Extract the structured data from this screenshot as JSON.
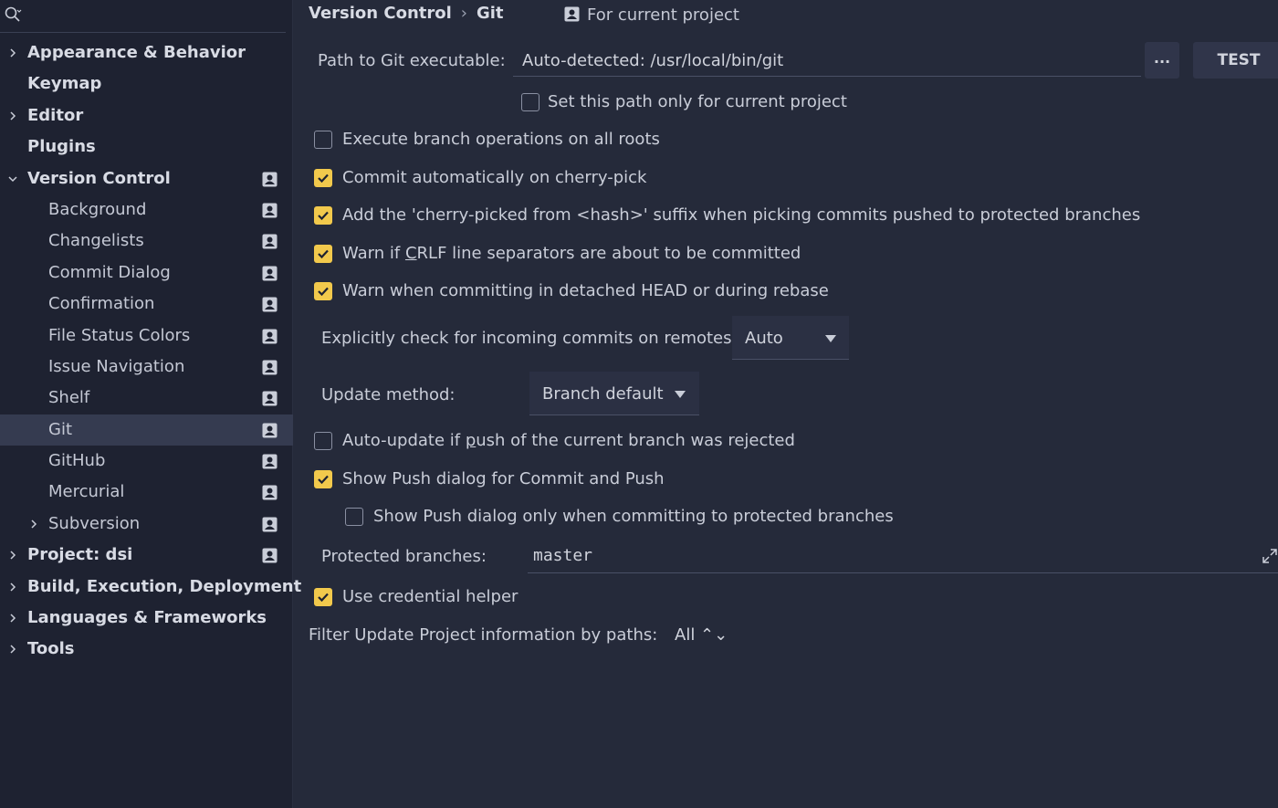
{
  "sidebar": {
    "search_icon": "search-icon",
    "items": [
      {
        "label": "Appearance & Behavior",
        "bold": true,
        "expandable": true,
        "expanded": false
      },
      {
        "label": "Keymap",
        "bold": true
      },
      {
        "label": "Editor",
        "bold": true,
        "expandable": true,
        "expanded": false
      },
      {
        "label": "Plugins",
        "bold": true
      },
      {
        "label": "Version Control",
        "bold": true,
        "expandable": true,
        "expanded": true,
        "project": true
      },
      {
        "label": "Background",
        "child": true,
        "project": true
      },
      {
        "label": "Changelists",
        "child": true,
        "project": true
      },
      {
        "label": "Commit Dialog",
        "child": true,
        "project": true
      },
      {
        "label": "Confirmation",
        "child": true,
        "project": true
      },
      {
        "label": "File Status Colors",
        "child": true,
        "project": true
      },
      {
        "label": "Issue Navigation",
        "child": true,
        "project": true
      },
      {
        "label": "Shelf",
        "child": true,
        "project": true
      },
      {
        "label": "Git",
        "child": true,
        "project": true,
        "selected": true
      },
      {
        "label": "GitHub",
        "child": true,
        "project": true
      },
      {
        "label": "Mercurial",
        "child": true,
        "project": true
      },
      {
        "label": "Subversion",
        "child": true,
        "project": true,
        "expandable": true
      },
      {
        "label": "Project: dsi",
        "bold": true,
        "expandable": true,
        "project": true
      },
      {
        "label": "Build, Execution, Deployment",
        "bold": true,
        "expandable": true
      },
      {
        "label": "Languages & Frameworks",
        "bold": true,
        "expandable": true
      },
      {
        "label": "Tools",
        "bold": true,
        "expandable": true
      }
    ]
  },
  "header": {
    "crumb1": "Version Control",
    "separator": "›",
    "crumb2": "Git",
    "for_project": "For current project"
  },
  "git": {
    "path_label": "Path to Git executable:",
    "path_value": "Auto-detected: /usr/local/bin/git",
    "browse_label": "...",
    "test_label": "TEST",
    "path_only_project": {
      "label": "Set this path only for current project",
      "checked": false
    },
    "execute_all_roots": {
      "label": "Execute branch operations on all roots",
      "checked": false
    },
    "commit_cherry_pick": {
      "label": "Commit automatically on cherry-pick",
      "checked": true
    },
    "cherry_suffix": {
      "label": "Add the 'cherry-picked from <hash>' suffix when picking commits pushed to protected branches",
      "checked": true
    },
    "warn_crlf": {
      "label_pre": "Warn if ",
      "label_u": "C",
      "label_post": "RLF line separators are about to be committed",
      "checked": true
    },
    "warn_detached": {
      "label": "Warn when committing in detached HEAD or during rebase",
      "checked": true
    },
    "incoming_label": "Explicitly check for incoming commits on remotes:",
    "incoming_value": "Auto",
    "update_method_label": "Update method:",
    "update_method_value": "Branch default",
    "auto_update": {
      "label_pre": "Auto-update if ",
      "label_u": "p",
      "label_post": "ush of the current branch was rejected",
      "checked": false
    },
    "show_push": {
      "label": "Show Push dialog for Commit and Push",
      "checked": true
    },
    "show_push_protected": {
      "label": "Show Push dialog only when committing to protected branches",
      "checked": false
    },
    "protected_label": "Protected branches:",
    "protected_value": "master",
    "credential_helper": {
      "label": "Use credential helper",
      "checked": true
    },
    "filter_label": "Filter Update Project information by paths:",
    "filter_value": "All ⌃⌄"
  },
  "colors": {
    "accent_checkbox": "#f2c94c",
    "background": "#252a3a",
    "sidebar": "#1e2231",
    "selected_row": "#353b50"
  }
}
